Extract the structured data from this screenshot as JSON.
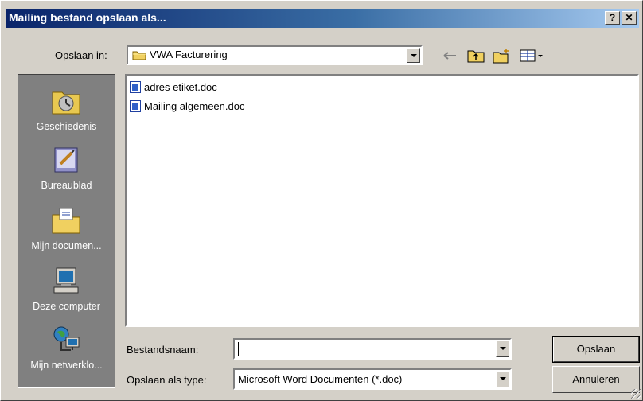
{
  "window": {
    "title": "Mailing bestand opslaan als...",
    "help_label": "?",
    "close_label": "✕"
  },
  "look_in": {
    "label": "Opslaan in:",
    "value": "VWA Facturering"
  },
  "places": [
    {
      "label": "Geschiedenis",
      "icon": "history-icon"
    },
    {
      "label": "Bureaublad",
      "icon": "desktop-icon"
    },
    {
      "label": "Mijn documen...",
      "icon": "my-documents-icon"
    },
    {
      "label": "Deze computer",
      "icon": "my-computer-icon"
    },
    {
      "label": "Mijn netwerklo...",
      "icon": "network-places-icon"
    }
  ],
  "files": [
    {
      "name": "adres etiket.doc",
      "icon": "word-doc-icon"
    },
    {
      "name": "Mailing algemeen.doc",
      "icon": "word-doc-icon"
    }
  ],
  "filename": {
    "label": "Bestandsnaam:",
    "value": ""
  },
  "filetype": {
    "label": "Opslaan als type:",
    "value": "Microsoft Word Documenten (*.doc)"
  },
  "buttons": {
    "save": "Opslaan",
    "cancel": "Annuleren"
  },
  "colors": {
    "titlebar_start": "#0a246a",
    "titlebar_end": "#a6caf0",
    "face": "#d4d0c8",
    "places_bg": "#808080"
  }
}
